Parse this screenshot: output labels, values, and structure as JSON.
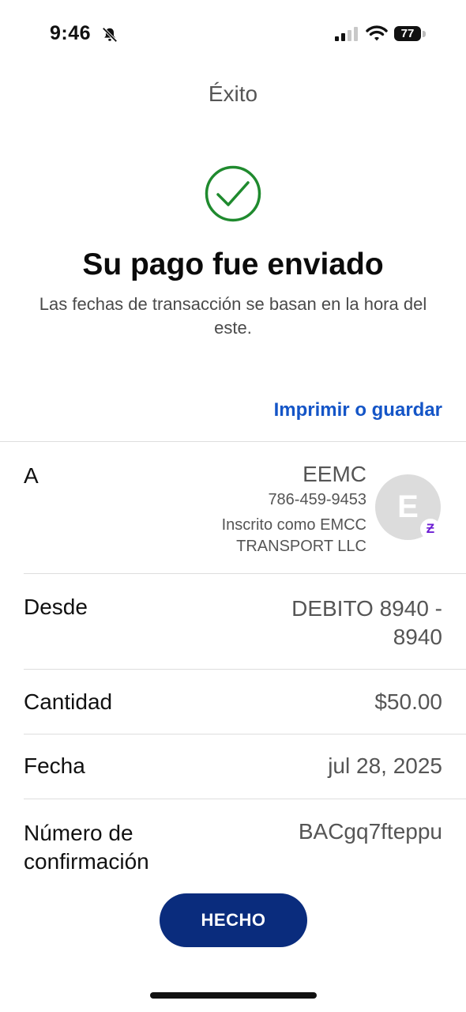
{
  "status_bar": {
    "time": "9:46",
    "battery": "77"
  },
  "header": {
    "title": "Éxito"
  },
  "confirmation": {
    "headline": "Su pago fue enviado",
    "note": "Las fechas de transacción se basan en la hora del este.",
    "print_link": "Imprimir o guardar",
    "success_color": "#1f8a2e"
  },
  "details": {
    "to": {
      "label": "A",
      "name": "EEMC",
      "phone": "786-459-9453",
      "enrolled": "Inscrito como EMCC TRANSPORT LLC",
      "avatar_initial": "E",
      "badge": "Ƶ"
    },
    "from": {
      "label": "Desde",
      "value": "DEBITO 8940 - 8940"
    },
    "amount": {
      "label": "Cantidad",
      "value": "$50.00"
    },
    "date": {
      "label": "Fecha",
      "value": "jul 28, 2025"
    },
    "confirmation_number": {
      "label": "Número de confirmación",
      "value": "BACgq7fteppu"
    }
  },
  "footer": {
    "done_label": "HECHO"
  },
  "colors": {
    "link": "#1455c7",
    "primary_button": "#0a2c7d",
    "zelle": "#6d1ed4"
  },
  "icons": [
    "bell-slash-icon",
    "cellular-signal-icon",
    "wifi-icon",
    "battery-icon",
    "checkmark-circle-icon"
  ]
}
